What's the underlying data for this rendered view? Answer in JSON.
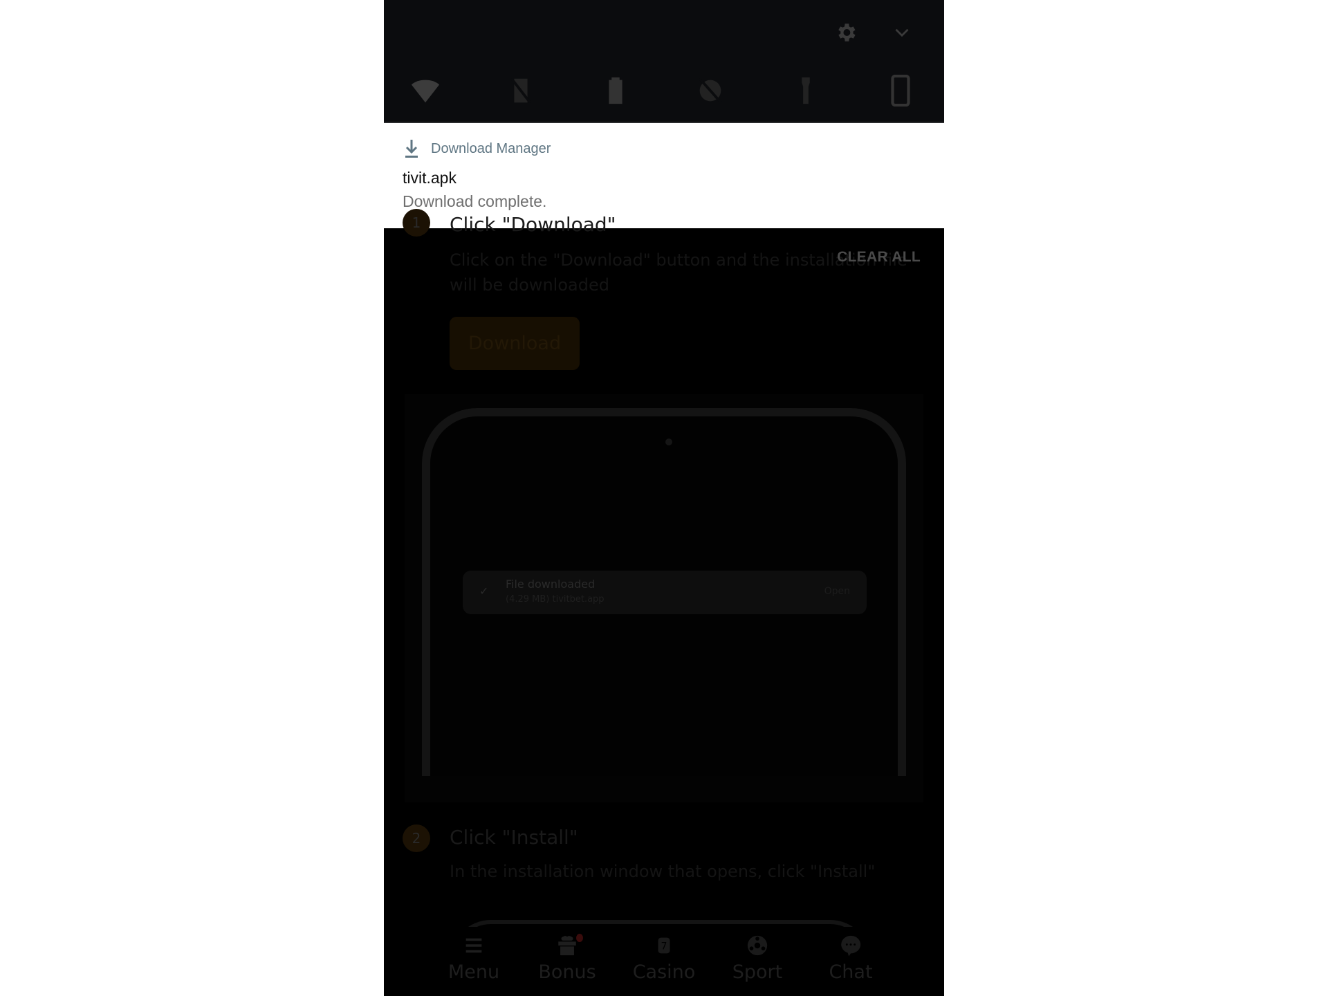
{
  "quick_settings": {
    "top_icons": [
      {
        "name": "settings",
        "icon": "gear-icon"
      },
      {
        "name": "collapse",
        "icon": "chevron-down-icon"
      }
    ],
    "tiles": [
      {
        "name": "wifi",
        "icon": "wifi-icon"
      },
      {
        "name": "mobile-data-off",
        "icon": "no-sim-icon"
      },
      {
        "name": "battery",
        "icon": "battery-icon"
      },
      {
        "name": "do-not-disturb-off",
        "icon": "dnd-off-icon"
      },
      {
        "name": "flashlight",
        "icon": "flashlight-icon"
      },
      {
        "name": "auto-rotate",
        "icon": "phone-rotate-icon"
      }
    ]
  },
  "notification": {
    "app_name": "Download Manager",
    "title": "tivit.apk",
    "body": "Download complete."
  },
  "shade": {
    "clear_all_label": "CLEAR ALL"
  },
  "page": {
    "step1": {
      "number": "1",
      "title": "Click \"Download\"",
      "description": "Click on the \"Download\" button and the installation file will be downloaded",
      "button_label": "Download",
      "mockup": {
        "card_title": "File downloaded",
        "card_subtitle": "(4.29 MB) tivitbet.app",
        "card_action": "Open"
      }
    },
    "step2": {
      "number": "2",
      "title": "Click \"Install\"",
      "description": "In the installation window that opens, click \"Install\""
    }
  },
  "bottom_nav": {
    "items": [
      {
        "label": "Menu",
        "icon": "menu-icon"
      },
      {
        "label": "Bonus",
        "icon": "gift-icon",
        "badge": true
      },
      {
        "label": "Casino",
        "icon": "casino-icon"
      },
      {
        "label": "Sport",
        "icon": "soccer-ball-icon"
      },
      {
        "label": "Chat",
        "icon": "chat-icon"
      }
    ]
  },
  "colors": {
    "shade_bg": "#0b0c0e",
    "notification_app": "#5f7683",
    "accent_dimmed": "#1c1204"
  }
}
